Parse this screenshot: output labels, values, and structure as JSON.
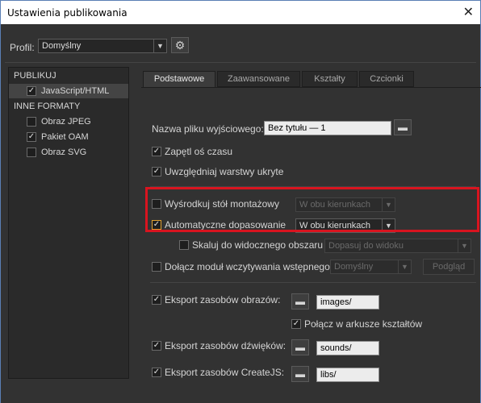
{
  "window": {
    "title": "Ustawienia publikowania",
    "close_glyph": "✕"
  },
  "profile": {
    "label": "Profil:",
    "value": "Domyślny",
    "gear_icon": "gear-icon"
  },
  "sidebar": {
    "section_publish": "PUBLIKUJ",
    "javascript_html": "JavaScript/HTML",
    "section_other": "INNE FORMATY",
    "items": [
      {
        "label": "Obraz JPEG",
        "checked": false
      },
      {
        "label": "Pakiet OAM",
        "checked": true
      },
      {
        "label": "Obraz SVG",
        "checked": false
      }
    ]
  },
  "tabs": [
    "Podstawowe",
    "Zaawansowane",
    "Kształty",
    "Czcionki"
  ],
  "basic": {
    "output_label": "Nazwa pliku wyjściowego:",
    "output_value": "Bez tytułu — 1",
    "loop_timeline": "Zapętl oś czasu",
    "include_hidden_layers": "Uwzględniaj warstwy ukryte",
    "center_stage": "Wyśrodkuj stół montażowy",
    "center_stage_value": "W obu kierunkach",
    "auto_fit": "Automatyczne dopasowanie",
    "auto_fit_value": "W obu kierunkach",
    "scale_visible": "Skaluj do widocznego obszaru",
    "scale_visible_value": "Dopasuj do widoku",
    "preloader": "Dołącz moduł wczytywania wstępnego",
    "preloader_value": "Domyślny",
    "preview_button": "Podgląd",
    "export_images": "Eksport zasobów obrazów:",
    "images_path": "images/",
    "combine_spritesheets": "Połącz w arkusze kształtów",
    "export_sounds": "Eksport zasobów dźwięków:",
    "sounds_path": "sounds/",
    "export_createjs": "Eksport zasobów CreateJS:",
    "libs_path": "libs/"
  },
  "colors": {
    "accent_highlight": "#d9141f",
    "background": "#323232"
  }
}
